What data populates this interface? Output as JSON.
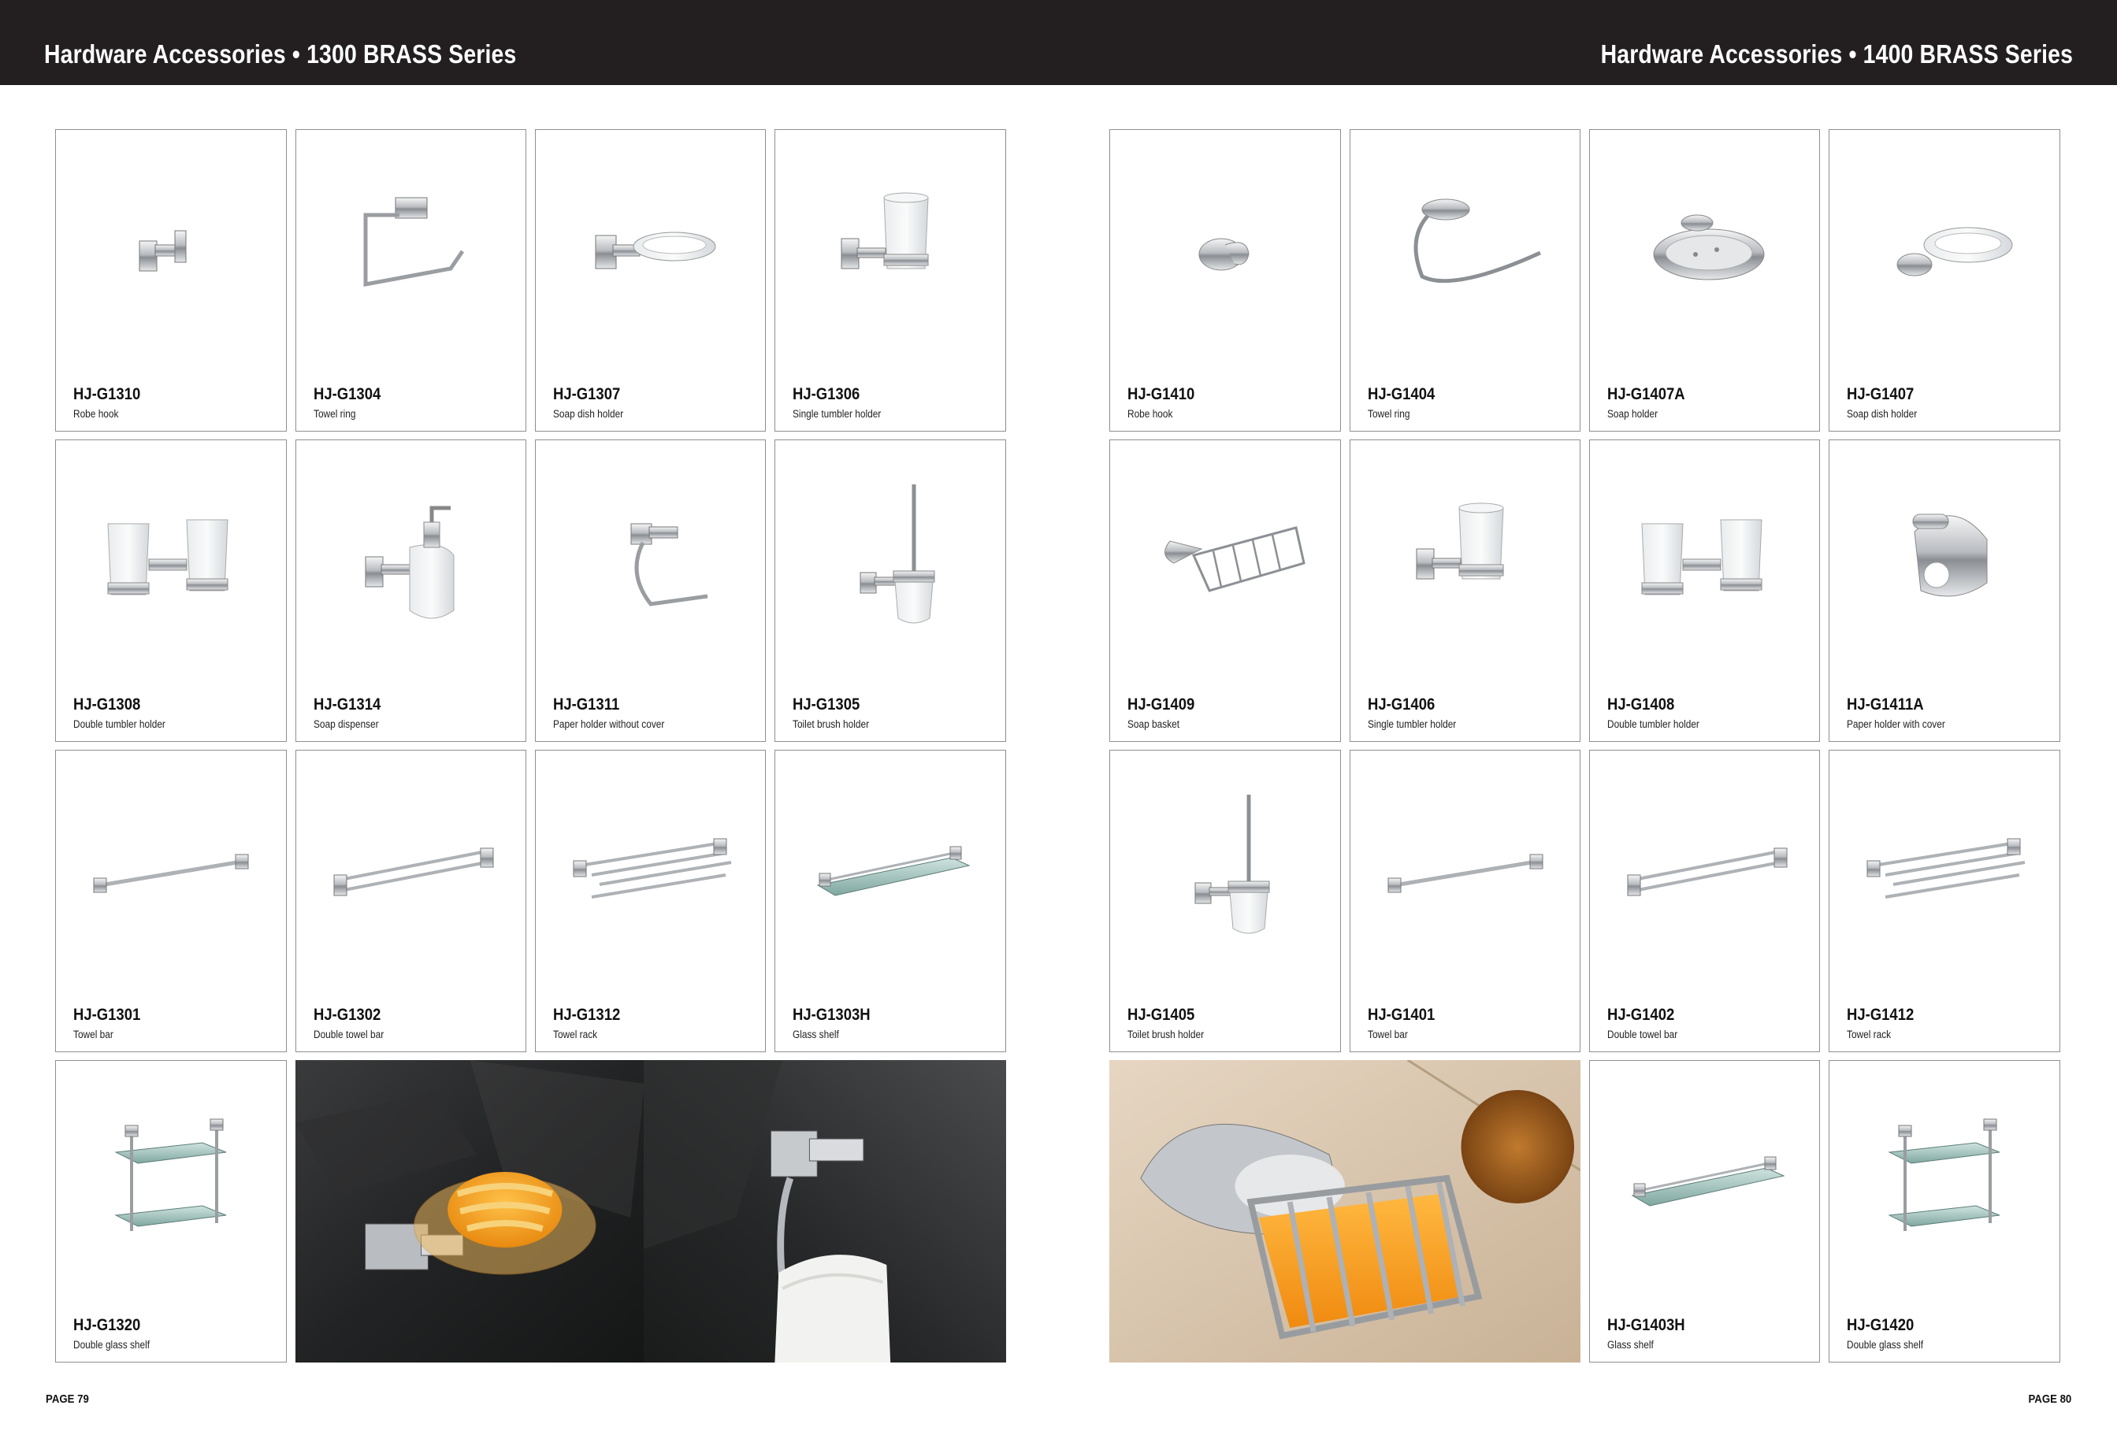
{
  "header": {
    "left_title": "Hardware Accessories • 1300 BRASS Series",
    "right_title": "Hardware Accessories • 1400 BRASS Series"
  },
  "left_page": {
    "page_number": "PAGE 79",
    "products": [
      {
        "code": "HJ-G1310",
        "desc": "Robe hook",
        "icon": "robe-hook-square"
      },
      {
        "code": "HJ-G1304",
        "desc": "Towel ring",
        "icon": "towel-ring-square"
      },
      {
        "code": "HJ-G1307",
        "desc": "Soap dish holder",
        "icon": "soap-dish-holder"
      },
      {
        "code": "HJ-G1306",
        "desc": "Single tumbler holder",
        "icon": "single-tumbler-holder"
      },
      {
        "code": "HJ-G1308",
        "desc": "Double tumbler holder",
        "icon": "double-tumbler-holder"
      },
      {
        "code": "HJ-G1314",
        "desc": "Soap dispenser",
        "icon": "soap-dispenser"
      },
      {
        "code": "HJ-G1311",
        "desc": "Paper holder without cover",
        "icon": "paper-holder"
      },
      {
        "code": "HJ-G1305",
        "desc": "Toilet brush holder",
        "icon": "toilet-brush-holder"
      },
      {
        "code": "HJ-G1301",
        "desc": "Towel bar",
        "icon": "towel-bar"
      },
      {
        "code": "HJ-G1302",
        "desc": "Double towel bar",
        "icon": "double-towel-bar"
      },
      {
        "code": "HJ-G1312",
        "desc": "Towel rack",
        "icon": "towel-rack"
      },
      {
        "code": "HJ-G1303H",
        "desc": "Glass shelf",
        "icon": "glass-shelf"
      },
      {
        "code": "HJ-G1320",
        "desc": "Double glass shelf",
        "icon": "double-glass-shelf"
      }
    ]
  },
  "right_page": {
    "page_number": "PAGE 80",
    "products": [
      {
        "code": "HJ-G1410",
        "desc": "Robe hook",
        "icon": "robe-hook-round"
      },
      {
        "code": "HJ-G1404",
        "desc": "Towel ring",
        "icon": "towel-ring-round"
      },
      {
        "code": "HJ-G1407A",
        "desc": "Soap holder",
        "icon": "soap-holder"
      },
      {
        "code": "HJ-G1407",
        "desc": "Soap dish holder",
        "icon": "soap-dish-holder-round"
      },
      {
        "code": "HJ-G1409",
        "desc": "Soap basket",
        "icon": "soap-basket"
      },
      {
        "code": "HJ-G1406",
        "desc": "Single tumbler holder",
        "icon": "single-tumbler-holder"
      },
      {
        "code": "HJ-G1408",
        "desc": "Double tumbler holder",
        "icon": "double-tumbler-holder"
      },
      {
        "code": "HJ-G1411A",
        "desc": "Paper holder with cover",
        "icon": "paper-holder-cover"
      },
      {
        "code": "HJ-G1405",
        "desc": "Toilet brush holder",
        "icon": "toilet-brush-holder"
      },
      {
        "code": "HJ-G1401",
        "desc": "Towel bar",
        "icon": "towel-bar"
      },
      {
        "code": "HJ-G1402",
        "desc": "Double towel bar",
        "icon": "double-towel-bar"
      },
      {
        "code": "HJ-G1412",
        "desc": "Towel rack",
        "icon": "towel-rack"
      },
      {
        "code": "HJ-G1403H",
        "desc": "Glass shelf",
        "icon": "glass-shelf"
      },
      {
        "code": "HJ-G1420",
        "desc": "Double glass shelf",
        "icon": "double-glass-shelf"
      }
    ]
  },
  "photos": {
    "left_soap_dish": "soap-dish-photo",
    "left_towel_ring": "towel-ring-photo",
    "right_soap_basket": "soap-basket-photo"
  },
  "colors": {
    "header_bg": "#231f20",
    "card_border": "#8f8f8f",
    "chrome": "#c9ccd0"
  }
}
